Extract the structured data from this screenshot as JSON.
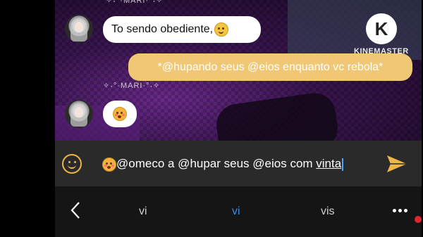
{
  "watermark": {
    "brand": "KINEMASTER",
    "logo_letter": "K"
  },
  "chat": {
    "sender_tag": "✧˖°·MARI·°˖✧",
    "messages": [
      {
        "from": "in",
        "text": "To sendo obediente,",
        "emoji": "smiling-face"
      },
      {
        "from": "out",
        "text": "*@hupando seus @eios enquanto vc rebola*"
      },
      {
        "from": "in",
        "text": "",
        "emoji": "flushed-face"
      }
    ]
  },
  "composer": {
    "emoji_prefix": "flushed-face",
    "value_main": "@omeco a @hupar seus @eios com ",
    "value_underlined": "vinta",
    "send_label": "send"
  },
  "keyboard": {
    "back": "back",
    "suggestions": [
      "vi",
      "vi",
      "vis"
    ],
    "suggestion_colors": [
      "#d0d0d0",
      "#3d8de0",
      "#d0d0d0"
    ]
  },
  "colors": {
    "accent": "#efc775",
    "send": "#f0b643",
    "record": "#e0262f"
  }
}
